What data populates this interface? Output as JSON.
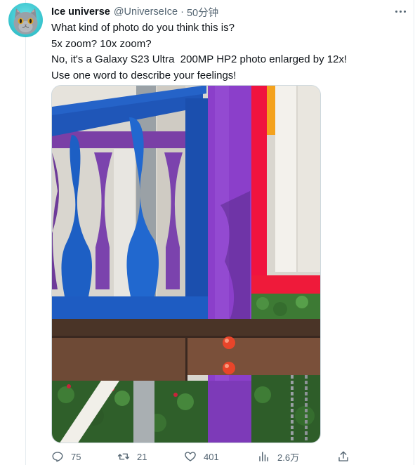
{
  "tweet": {
    "author": {
      "display_name": "Ice universe",
      "handle": "@UniverseIce",
      "avatar_icon": "cat-avatar"
    },
    "separator": "·",
    "time": "50分钟",
    "text_lines": [
      "What kind of photo do you think this is?",
      "5x zoom? 10x zoom?",
      "No, it's a Galaxy S23 Ultra  200MP HP2 photo enlarged by 12x!",
      "Use one word to describe your feelings!"
    ],
    "media": {
      "kind": "photo",
      "subject_colors": {
        "blue": "#1f5dc0",
        "purple": "#8c3fc8",
        "red": "#f0133f",
        "wood": "#5a3d2c",
        "knob": "#e8452a"
      }
    },
    "actions": {
      "reply": {
        "icon": "reply-icon",
        "count": "75"
      },
      "retweet": {
        "icon": "retweet-icon",
        "count": "21"
      },
      "like": {
        "icon": "like-icon",
        "count": "401"
      },
      "views": {
        "icon": "views-icon",
        "count": "2.6万"
      },
      "share": {
        "icon": "share-icon"
      }
    },
    "more_icon": "more-icon"
  },
  "colors": {
    "text_primary": "#0f1419",
    "text_secondary": "#536471",
    "border": "#cfd9de"
  }
}
